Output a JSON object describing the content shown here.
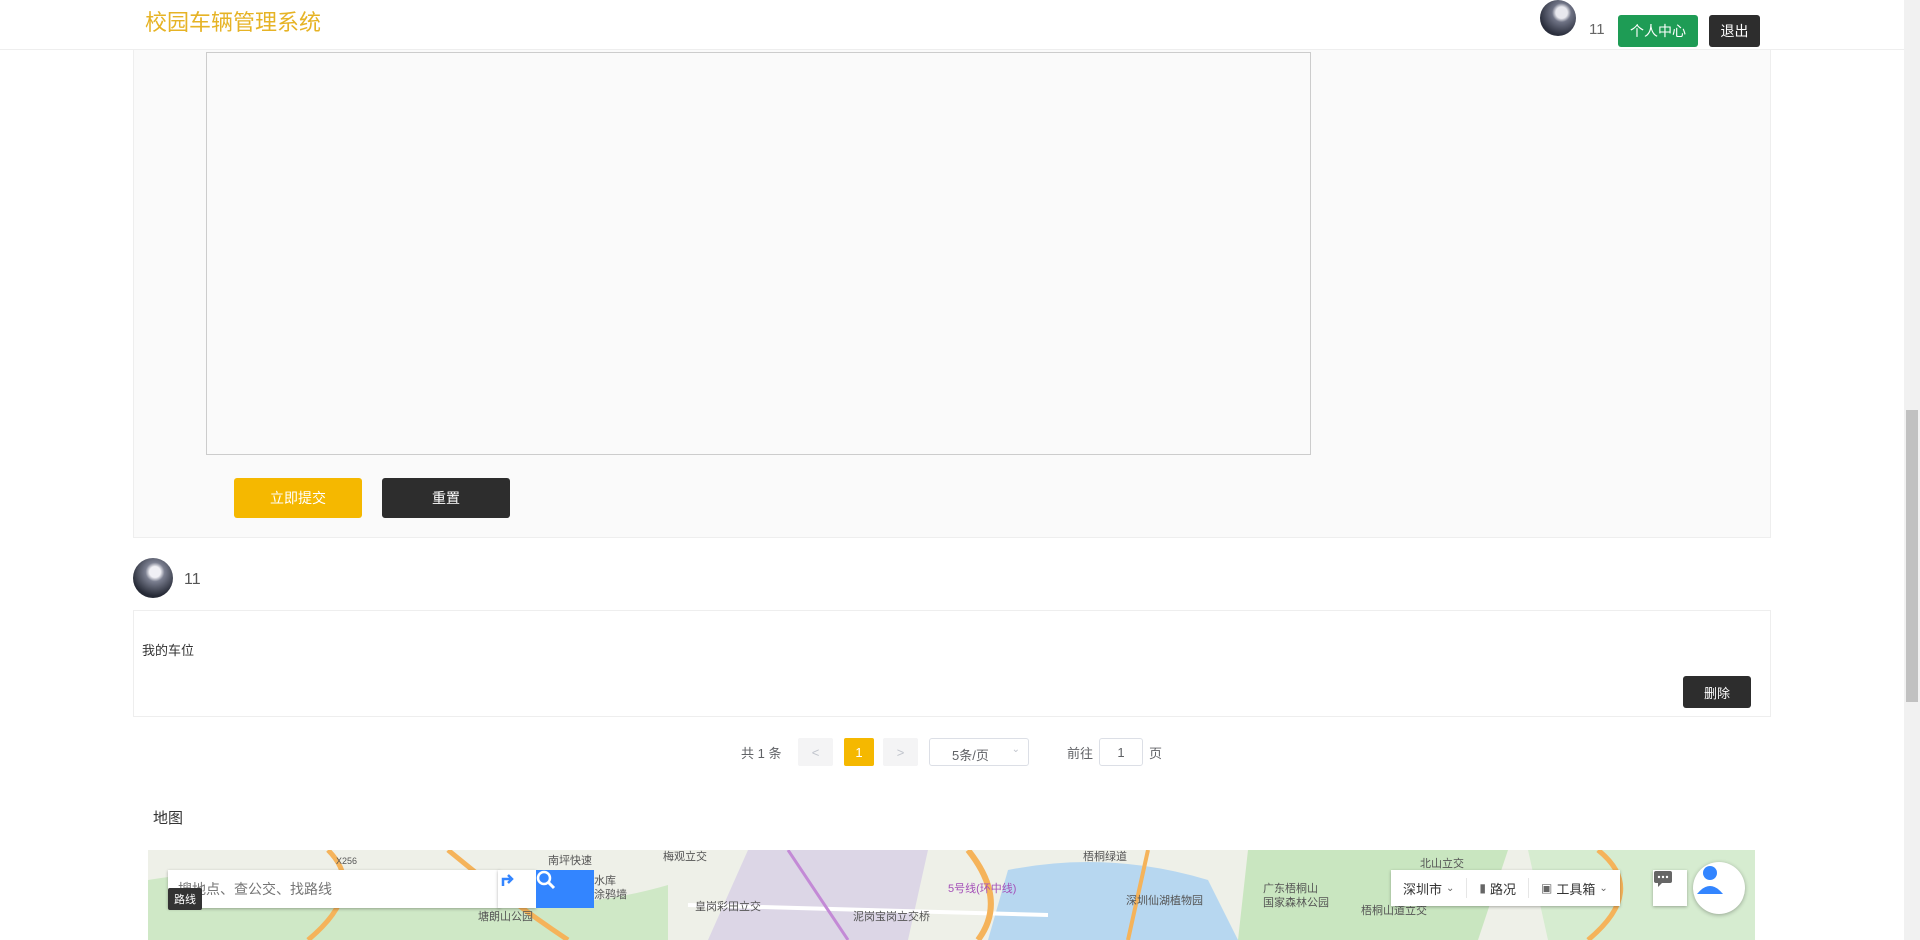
{
  "header": {
    "brand": "校园车辆管理系统",
    "username": "11",
    "personal_center": "个人中心",
    "logout": "退出"
  },
  "form": {
    "submit_label": "立即提交",
    "reset_label": "重置"
  },
  "comment": {
    "username": "11",
    "text": "我的车位",
    "delete_label": "删除"
  },
  "pagination": {
    "total_text": "共 1 条",
    "prev": "<",
    "current_page": "1",
    "next": ">",
    "page_size": "5条/页",
    "goto_label": "前往",
    "goto_value": "1",
    "page_suffix": "页"
  },
  "map": {
    "title": "地图",
    "search_placeholder": "搜地点、查公交、找路线",
    "route_tip": "路线",
    "city": "深圳市",
    "traffic": "路况",
    "toolbox": "工具箱",
    "labels": [
      "南坪快速",
      "梅观立交",
      "水库",
      "涂鸦墙",
      "塘朗山公园",
      "皇岗彩田立交",
      "泥岗宝岗立交桥",
      "5号线(环中线)",
      "梧桐绿道",
      "深圳仙湖植物园",
      "广东梧桐山",
      "国家森林公园",
      "北山立交",
      "梧桐山道立交",
      "X256"
    ]
  }
}
